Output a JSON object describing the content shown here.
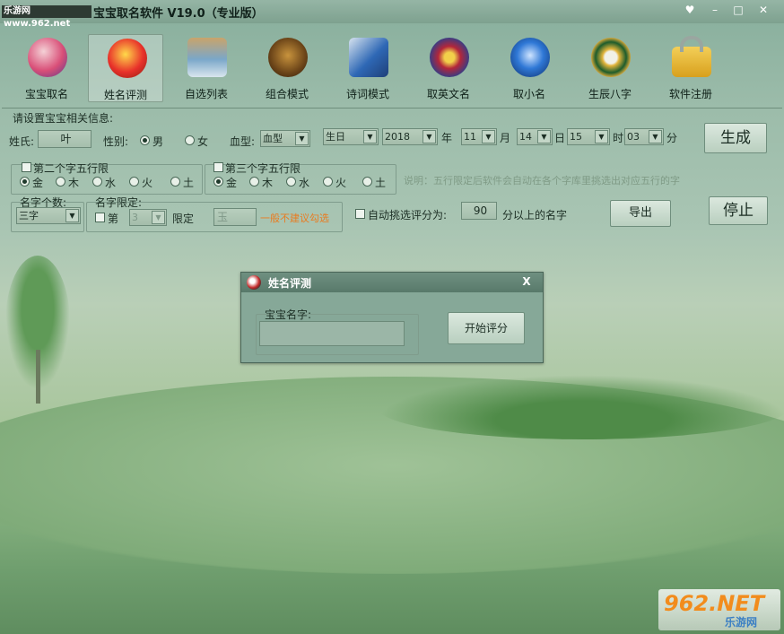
{
  "title_bar": {
    "badge": "乐游网 www.962.net",
    "title": "宝宝取名软件 V19.0（专业版）"
  },
  "toolbar": {
    "items": [
      {
        "label": "宝宝取名",
        "active": false
      },
      {
        "label": "姓名评测",
        "active": true
      },
      {
        "label": "自选列表",
        "active": false
      },
      {
        "label": "组合模式",
        "active": false
      },
      {
        "label": "诗词模式",
        "active": false
      },
      {
        "label": "取英文名",
        "active": false
      },
      {
        "label": "取小名",
        "active": false
      },
      {
        "label": "生辰八字",
        "active": false
      },
      {
        "label": "软件注册",
        "active": false
      }
    ]
  },
  "form": {
    "section_title": "请设置宝宝相关信息:",
    "surname_label": "姓氏:",
    "surname_value": "叶",
    "gender_label": "性别:",
    "gender_male": "男",
    "gender_female": "女",
    "blood_label": "血型:",
    "blood_value": "血型",
    "birth_type": "生日",
    "year_value": "2018",
    "year_label": "年",
    "month_value": "11",
    "month_label": "月",
    "day_value": "14",
    "day_label": "日",
    "hour_value": "15",
    "hour_label": "时",
    "minute_value": "03",
    "minute_label": "分",
    "second_char_limit": "第二个字五行限",
    "third_char_limit": "第三个字五行限",
    "elements": [
      "金",
      "木",
      "水",
      "火",
      "土"
    ],
    "note_text": "说明：五行限定后软件会自动在各个字库里挑选出对应五行的字",
    "name_count_label": "名字个数:",
    "name_count_value": "三字",
    "name_limit_label": "名字限定:",
    "limit_pos_label": "第",
    "limit_pos_value": "3",
    "limit_label": "限定",
    "limit_char_value": "玉",
    "limit_hint": "一般不建议勾选",
    "auto_select_label": "自动挑选评分为:",
    "score_value": "90",
    "score_suffix": "分以上的名字"
  },
  "buttons": {
    "generate": "生成",
    "export": "导出",
    "stop": "停止"
  },
  "dialog": {
    "title": "姓名评测",
    "close": "X",
    "field_label": "宝宝名字:",
    "field_value": "",
    "start_button": "开始评分"
  },
  "watermark": {
    "brand": "962.NET",
    "sub": "乐游网"
  },
  "colors": {
    "accent": "#e97b1f",
    "sky": "#9cbcaa",
    "grass": "#7fae79"
  }
}
